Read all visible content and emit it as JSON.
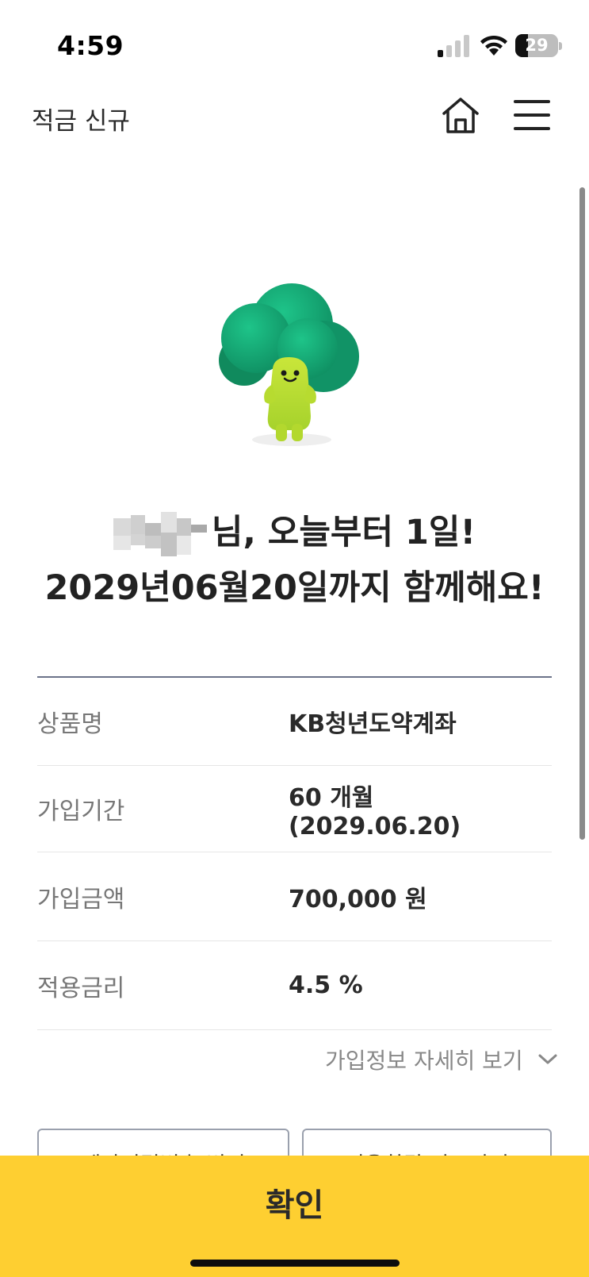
{
  "status_bar": {
    "time": "4:59",
    "battery_level": "29",
    "battery_fraction": 0.29
  },
  "header": {
    "title": "적금 신규"
  },
  "headline": {
    "line1_suffix": "님, 오늘부터 1일!",
    "line2": "2029년06월20일까지 함께해요!"
  },
  "info": {
    "rows": [
      {
        "label": "상품명",
        "value": "KB청년도약계좌"
      },
      {
        "label": "가입기간",
        "value": "60 개월 (2029.06.20)"
      },
      {
        "label": "가입금액",
        "value": "700,000 원"
      },
      {
        "label": "적용금리",
        "value": "4.5 %"
      }
    ],
    "detail_link": "가입정보 자세히 보기"
  },
  "sub_buttons": {
    "left": "계좌비밀번호 변경",
    "right": "적용한말 바로가기"
  },
  "confirm": {
    "label": "확인"
  },
  "colors": {
    "accent_yellow": "#fecf31",
    "divider_navy": "#6b7389",
    "broccoli_dark": "#12996a",
    "broccoli_light": "#b5dc2a"
  }
}
